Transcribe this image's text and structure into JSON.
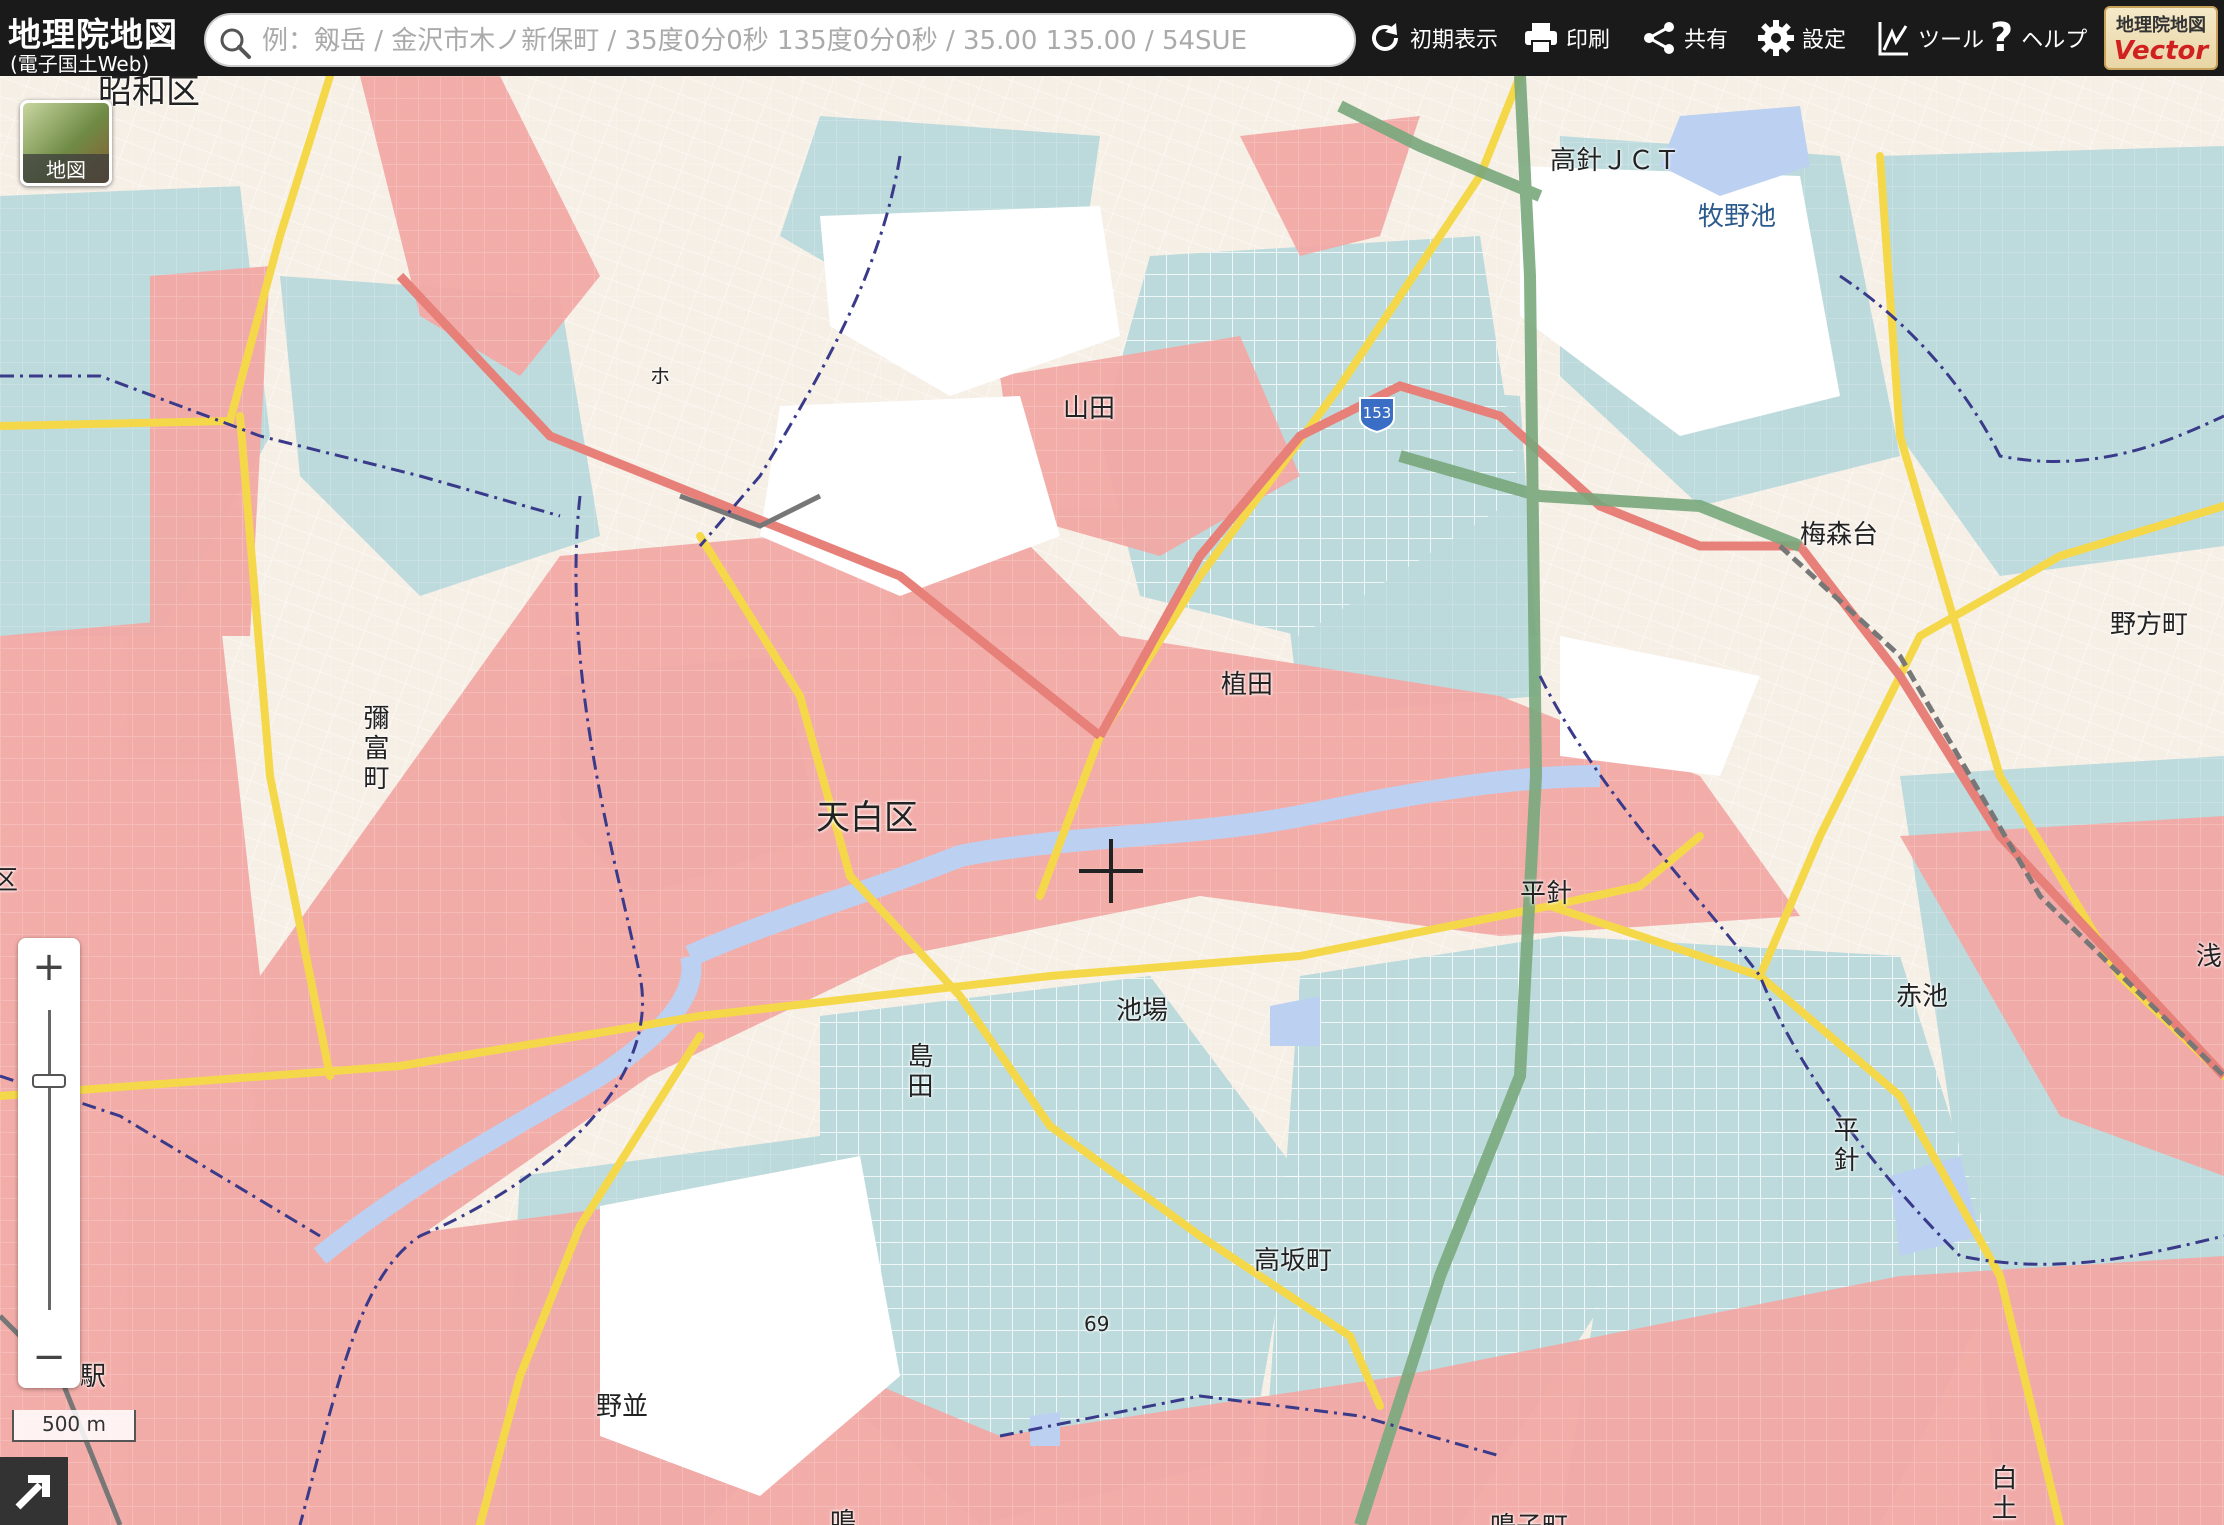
{
  "header": {
    "logo_main": "地理院地図",
    "logo_sub": "(電子国土Web)",
    "search_placeholder": "例：剱岳 / 金沢市木ノ新保町 / 35度0分0秒 135度0分0秒 / 35.00 135.00 / 54SUE",
    "buttons": {
      "reset": "初期表示",
      "print": "印刷",
      "share": "共有",
      "settings": "設定",
      "tools": "ツール",
      "help": "ヘルプ"
    },
    "vector_badge_top": "地理院地図",
    "vector_badge_bottom": "Vector"
  },
  "map": {
    "layer_label": "地図",
    "scale_label": "500 m",
    "zoom_in": "+",
    "zoom_out": "−",
    "place_labels": {
      "showa": "昭和区",
      "tenpaku": "天白区",
      "yamada": "山田",
      "ueda": "植田",
      "hirabari": "平針",
      "hirabari2": "平針",
      "ikeba": "池場",
      "shimada": "島田",
      "yatomi": "彌富町",
      "takasaka": "高坂町",
      "nonami": "野並",
      "umemoridai": "梅森台",
      "nokata": "野方町",
      "akaike": "赤池",
      "makinoike": "牧野池",
      "takabari_jct": "高針ＪＣＴ",
      "ku_left": "区",
      "asa": "浅",
      "shiro": "白土",
      "eki": "駅",
      "naru": "鳴",
      "naruko": "鳴子町",
      "route": "153",
      "elev": "69",
      "ku2": "ホ"
    },
    "colors": {
      "built_up": "#f2a9a5",
      "residential": "#b8d8dc",
      "water": "#bcd0f2",
      "major_road": "#f5d84a",
      "expressway": "#79a87c"
    }
  }
}
